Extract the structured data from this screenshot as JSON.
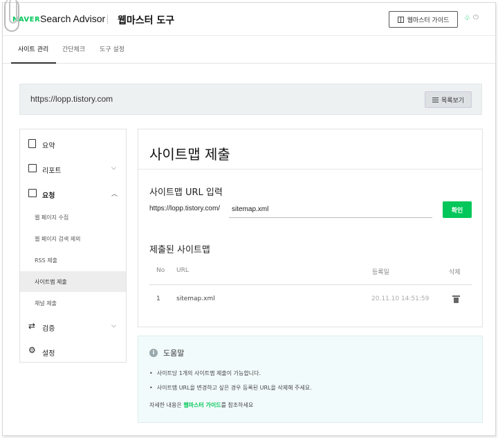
{
  "header": {
    "brand": "NAVER",
    "product": "Search Advisor",
    "title": "웹마스터 도구",
    "guide_button": "웹마스터 가이드",
    "user_icon": "clover-icon",
    "power_icon": "power-icon"
  },
  "tabs": [
    {
      "label": "사이트 관리",
      "active": true
    },
    {
      "label": "간단체크",
      "active": false
    },
    {
      "label": "도구 설정",
      "active": false
    }
  ],
  "site": {
    "url": "https://lopp.tistory.com",
    "list_button": "목록보기"
  },
  "sidebar": {
    "items": [
      {
        "label": "요약",
        "icon": "summary-icon"
      },
      {
        "label": "리포트",
        "icon": "report-icon",
        "chevron": "down"
      },
      {
        "label": "요청",
        "icon": "request-icon",
        "chevron": "up"
      },
      {
        "label": "검증",
        "icon": "verify-icon",
        "chevron": "down"
      },
      {
        "label": "설정",
        "icon": "gear-icon"
      }
    ],
    "sub_items": [
      {
        "label": "웹 페이지 수집",
        "active": false
      },
      {
        "label": "웹 페이지 검색 제외",
        "active": false
      },
      {
        "label": "RSS 제출",
        "active": false
      },
      {
        "label": "사이트맵 제출",
        "active": true
      },
      {
        "label": "채널 제출",
        "active": false
      }
    ]
  },
  "main": {
    "title": "사이트맵 제출",
    "input_label": "사이트맵 URL 입력",
    "url_prefix": "https://lopp.tistory.com/",
    "input_value": "sitemap.xml",
    "confirm_button": "확인",
    "submitted_label": "제출된 사이트맵",
    "table": {
      "headers": [
        "No",
        "URL",
        "등록일",
        "삭제"
      ],
      "rows": [
        {
          "no": "1",
          "url": "sitemap.xml",
          "date": "20.11.10 14:51:59"
        }
      ]
    }
  },
  "help": {
    "title": "도움말",
    "bullets": [
      "사이트당 1개의 사이트맵 제출이 가능합니다.",
      "사이트맵 URL을 변경하고 싶은 경우 등록된 URL을 삭제해 주세요."
    ],
    "more_prefix": "자세한 내용은 ",
    "more_link": "웹마스터 가이드",
    "more_suffix": "를 참조하세요"
  },
  "colors": {
    "accent": "#03c75a",
    "panel_bg": "#eef1f2",
    "help_bg": "#f2fbfb"
  }
}
